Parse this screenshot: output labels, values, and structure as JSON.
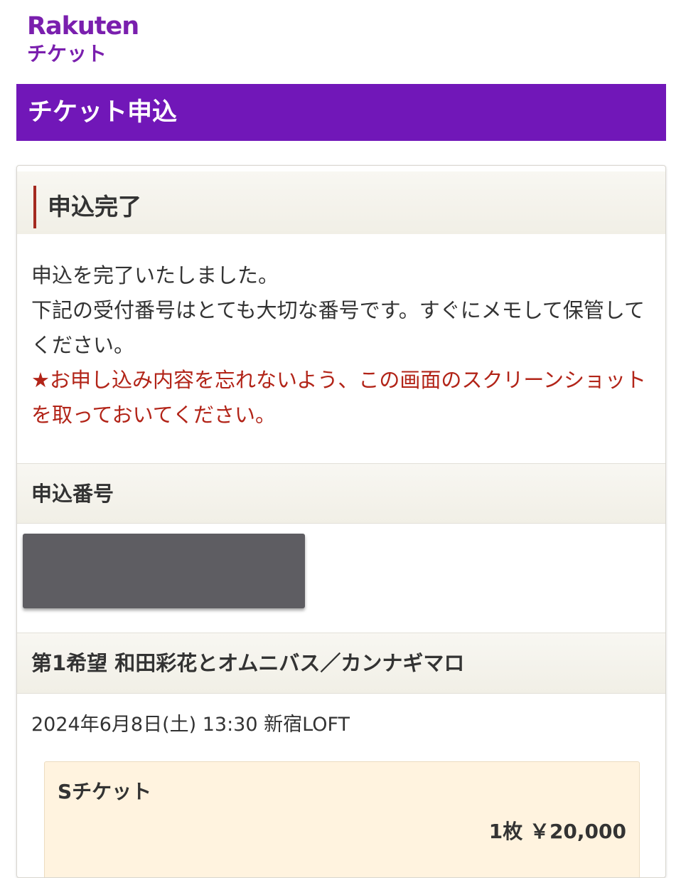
{
  "brand": {
    "logo_top": "Rakuten",
    "logo_bottom": "チケット",
    "color": "#7a1fae"
  },
  "header": {
    "title": "チケット申込",
    "bg_color": "#7117b8"
  },
  "complete_section": {
    "title": "申込完了",
    "lines": [
      "申込を完了いたしました。",
      "下記の受付番号はとても大切な番号です。すぐにメモして保管してください。"
    ],
    "notice": "★お申し込み内容を忘れないよう、この画面のスクリーンショットを取っておいてください。",
    "notice_color": "#b22418"
  },
  "application_number": {
    "label": "申込番号"
  },
  "choice": {
    "title": "第1希望 和田彩花とオムニバス／カンナギマロ",
    "datetime_venue": "2024年6月8日(土) 13:30 新宿LOFT",
    "ticket": {
      "type": "Sチケット",
      "quantity_price": "1枚 ￥20,000"
    }
  }
}
